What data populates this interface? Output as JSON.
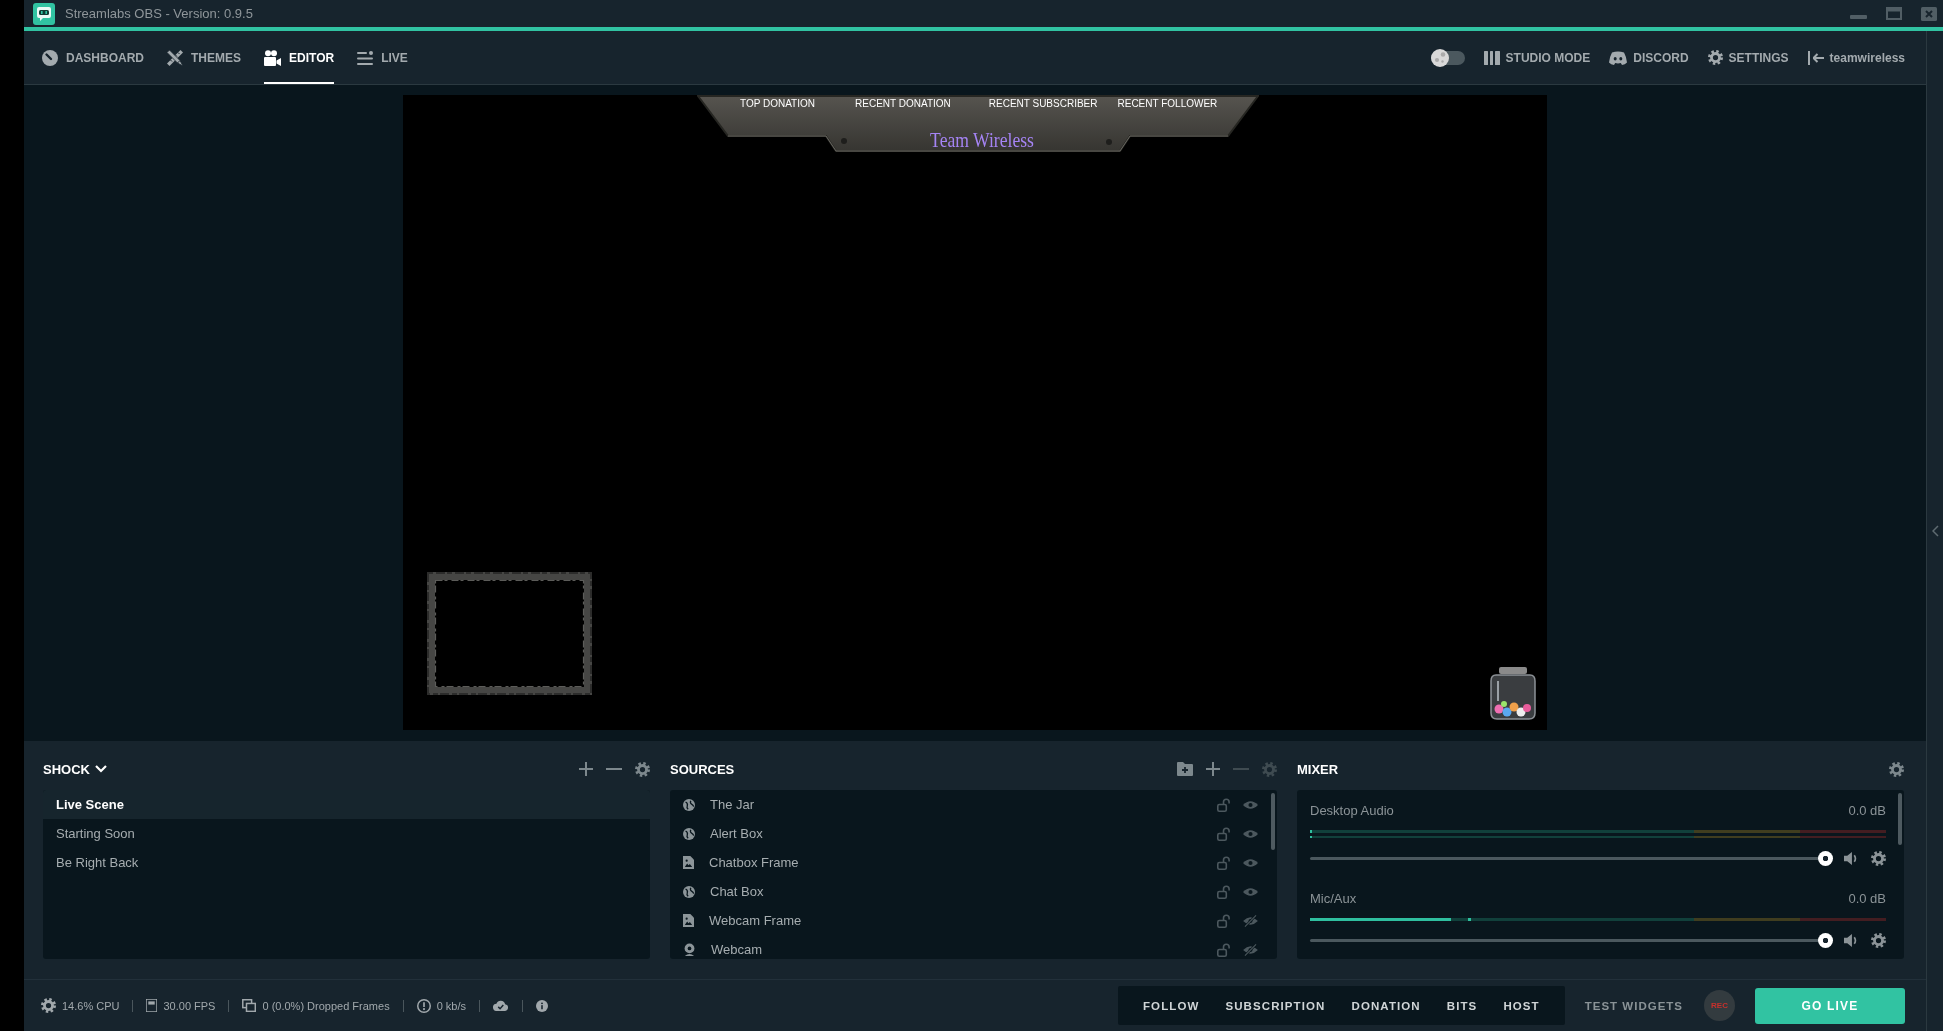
{
  "window": {
    "title": "Streamlabs OBS - Version: 0.9.5"
  },
  "nav": {
    "tabs": [
      {
        "kind": "dashboard",
        "label": "DASHBOARD",
        "selected": false
      },
      {
        "kind": "themes",
        "label": "THEMES",
        "selected": false
      },
      {
        "kind": "editor",
        "label": "EDITOR",
        "selected": true
      },
      {
        "kind": "live",
        "label": "LIVE",
        "selected": false
      }
    ],
    "night_mode_toggle": {
      "on": false
    },
    "links": [
      {
        "kind": "studio",
        "label": "STUDIO MODE"
      },
      {
        "kind": "discord",
        "label": "DISCORD"
      },
      {
        "kind": "settings",
        "label": "SETTINGS"
      },
      {
        "kind": "account",
        "label": "teamwireless"
      }
    ]
  },
  "preview": {
    "overlay_labels": [
      "TOP DONATION",
      "RECENT DONATION",
      "RECENT SUBSCRIBER",
      "RECENT FOLLOWER"
    ],
    "overlay_title": "Team Wireless"
  },
  "scenes": {
    "collection": "SHOCK",
    "tools": [
      {
        "kind": "add",
        "disabled": false
      },
      {
        "kind": "remove",
        "disabled": false
      },
      {
        "kind": "settings",
        "disabled": false
      }
    ],
    "items": [
      {
        "name": "Live Scene",
        "selected": true
      },
      {
        "name": "Starting Soon",
        "selected": false
      },
      {
        "name": "Be Right Back",
        "selected": false
      }
    ]
  },
  "sources": {
    "title": "SOURCES",
    "tools": [
      {
        "kind": "add_folder",
        "disabled": false
      },
      {
        "kind": "add",
        "disabled": false
      },
      {
        "kind": "remove",
        "disabled": true
      },
      {
        "kind": "settings",
        "disabled": true
      }
    ],
    "items": [
      {
        "kind": "browser",
        "name": "The Jar",
        "locked": false,
        "visible": true
      },
      {
        "kind": "browser",
        "name": "Alert Box",
        "locked": false,
        "visible": true
      },
      {
        "kind": "image",
        "name": "Chatbox Frame",
        "locked": false,
        "visible": true
      },
      {
        "kind": "browser",
        "name": "Chat Box",
        "locked": false,
        "visible": true
      },
      {
        "kind": "image",
        "name": "Webcam Frame",
        "locked": false,
        "visible": false
      },
      {
        "kind": "webcam",
        "name": "Webcam",
        "locked": false,
        "visible": false
      }
    ]
  },
  "mixer": {
    "title": "MIXER",
    "channels": [
      {
        "name": "Desktop Audio",
        "reading": "0.0 dB",
        "meters": [
          {
            "level": 0.003
          },
          {
            "level": 0.003
          }
        ],
        "volume": {
          "level": 1
        },
        "muted": false
      },
      {
        "name": "Mic/Aux",
        "reading": "0.0 dB",
        "meters": [
          {
            "level": 0.245
          }
        ],
        "volume": {
          "level": 1
        },
        "muted": false
      }
    ]
  },
  "status_bar": {
    "stats": [
      {
        "kind": "cpu",
        "text": "14.6% CPU"
      },
      {
        "kind": "fps",
        "text": "30.00 FPS"
      },
      {
        "kind": "dropped",
        "text": "0 (0.0%) Dropped Frames"
      },
      {
        "kind": "bandwidth",
        "text": "0 kb/s"
      }
    ],
    "widget_tests": [
      "FOLLOW",
      "SUBSCRIPTION",
      "DONATION",
      "BITS",
      "HOST"
    ],
    "test_widgets_label": "TEST WIDGETS",
    "record": {
      "label": "REC",
      "recording": false
    },
    "go_live": "GO LIVE"
  }
}
